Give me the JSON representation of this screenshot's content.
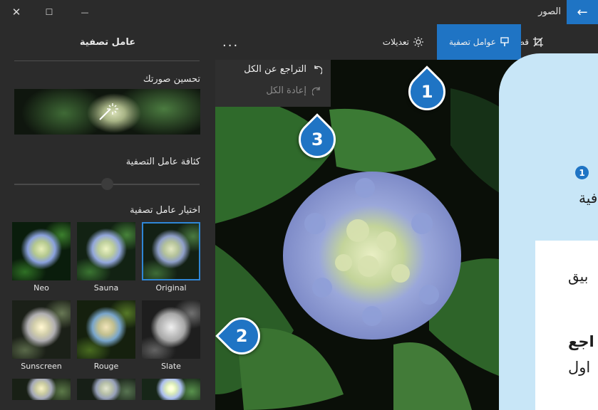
{
  "window": {
    "title": "الصور",
    "close_glyph": "✕",
    "maximize_glyph": "☐",
    "minimize_glyph": "—",
    "back_glyph": "←"
  },
  "commandbar": {
    "crop_label": "قص وتدوير",
    "filters_label": "عوامل تصفية",
    "adjust_label": "تعديلات",
    "more_label": "..."
  },
  "menu": {
    "undo_all": "التراجع عن الكل",
    "redo_all": "إعادة الكل"
  },
  "panel": {
    "title": "عامل تصفية",
    "enhance_label": "تحسين صورتك",
    "intensity_label": "كثافة عامل التصفية",
    "intensity_value": 0.5,
    "choose_label": "اختيار عامل تصفية",
    "filters": [
      {
        "name": "Original",
        "selected": true
      },
      {
        "name": "Sauna",
        "selected": false
      },
      {
        "name": "Neo",
        "selected": false
      },
      {
        "name": "Slate",
        "selected": false
      },
      {
        "name": "Rouge",
        "selected": false
      },
      {
        "name": "Sunscreen",
        "selected": false
      }
    ]
  },
  "markers": [
    "1",
    "2",
    "3"
  ],
  "sidecard": {
    "badge": "1",
    "line1": "فية",
    "line2": "بيق",
    "line3": "اجع",
    "line4": "اول"
  },
  "colors": {
    "accent": "#1f74c4",
    "panel_bg": "#2b2b2b",
    "sidecard_bg": "#c8e6f7"
  }
}
